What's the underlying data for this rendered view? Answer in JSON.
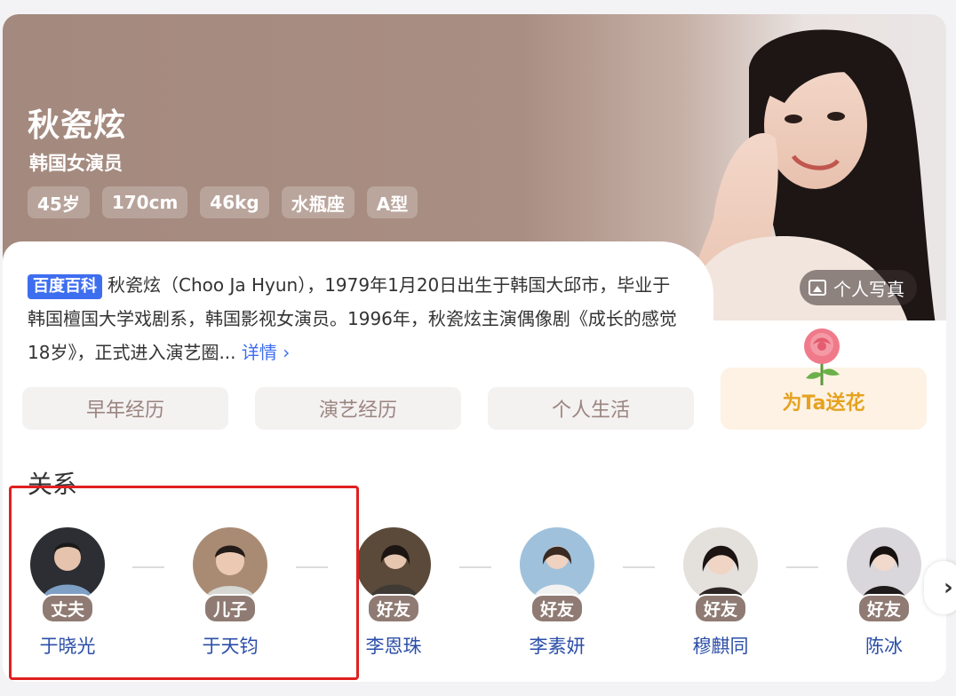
{
  "person": {
    "name": "秋瓷炫",
    "subtitle": "韩国女演员",
    "tags": [
      "45岁",
      "170cm",
      "46kg",
      "水瓶座",
      "A型"
    ]
  },
  "photo_button": {
    "label": "个人写真",
    "icon": "image-icon"
  },
  "summary": {
    "source_badge": "百度百科",
    "text": "秋瓷炫（Choo Ja Hyun），1979年1月20日出生于韩国大邱市，毕业于韩国檀国大学戏剧系，韩国影视女演员。1996年，秋瓷炫主演偶像剧《成长的感觉18岁》，正式进入演艺圈...",
    "more_label": "详情 ›"
  },
  "sections": [
    "早年经历",
    "演艺经历",
    "个人生活"
  ],
  "flower_button": {
    "label": "为Ta送花",
    "icon": "rose-icon"
  },
  "relations": {
    "title": "关系",
    "items": [
      {
        "role": "丈夫",
        "name": "于晓光"
      },
      {
        "role": "儿子",
        "name": "于天钧"
      },
      {
        "role": "好友",
        "name": "李恩珠"
      },
      {
        "role": "好友",
        "name": "李素妍"
      },
      {
        "role": "好友",
        "name": "穆麒同"
      },
      {
        "role": "好友",
        "name": "陈冰"
      }
    ],
    "next_label": "›"
  },
  "colors": {
    "hero_brown": "#a4897e",
    "accent_blue": "#3e6ef0",
    "flower_orange": "#e6a21f",
    "highlight_red": "#e02020"
  }
}
